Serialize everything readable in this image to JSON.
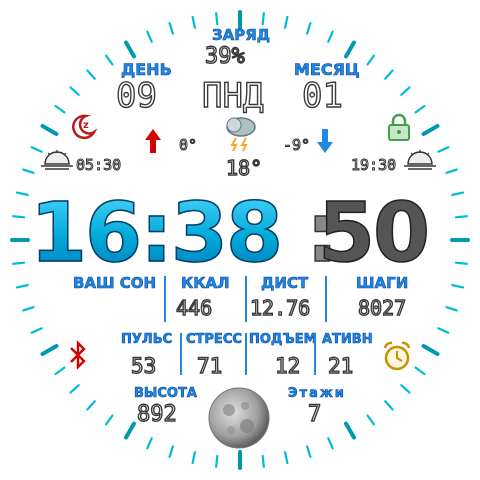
{
  "battery": {
    "label": "ЗАРЯД",
    "value": "39%"
  },
  "date": {
    "day_label": "ДЕНЬ",
    "day_value": "09",
    "weekday": "ПНД",
    "month_label": "МЕСЯЦ",
    "month_value": "01"
  },
  "weather": {
    "temp_low": "0°",
    "temp_high": "-9°",
    "temp_current": "18°",
    "icon": "thunder-cloud-icon"
  },
  "sun": {
    "sunrise": "05:30",
    "sunset": "19:30"
  },
  "time": {
    "hours_minutes": "16:38",
    "colon": ":",
    "seconds": "50"
  },
  "stats_row1": [
    {
      "label": "ВАШ СОН",
      "value": ""
    },
    {
      "label": "ККАЛ",
      "value": "446"
    },
    {
      "label": "ДИСТ",
      "value": "12.76"
    },
    {
      "label": "ШАГИ",
      "value": "8027"
    }
  ],
  "stats_row2": [
    {
      "label": "ПУЛЬС",
      "value": "53"
    },
    {
      "label": "СТРЕСС",
      "value": "71"
    },
    {
      "label": "ПОДЪЕМ",
      "value": "12"
    },
    {
      "label": "АТИВН",
      "value": "21"
    }
  ],
  "altitude": {
    "label": "ВЫСОТА",
    "value": "892"
  },
  "floors": {
    "label": "Этажи",
    "value": "7"
  },
  "colors": {
    "accent": "#1e88e5",
    "tick": "#00bcd4",
    "alert": "#d32f2f",
    "lock": "#43a047",
    "alarm": "#d49a00"
  }
}
